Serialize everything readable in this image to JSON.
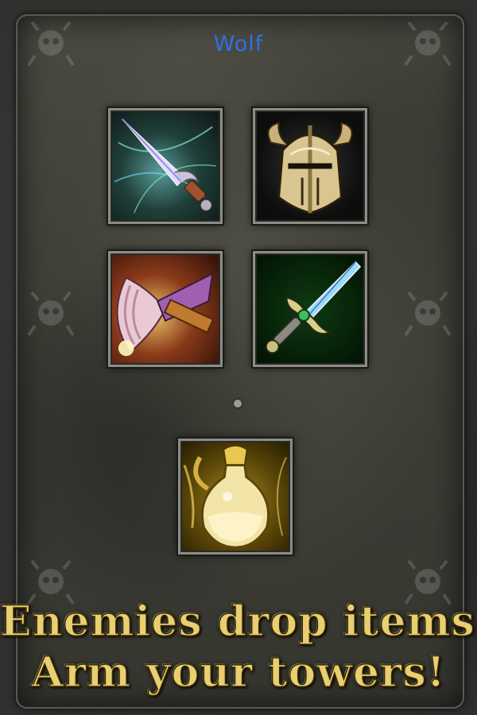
{
  "unit": {
    "name": "Wolf"
  },
  "items": [
    {
      "icon": "enchanted-dagger-icon"
    },
    {
      "icon": "golden-helmet-icon"
    },
    {
      "icon": "battle-axe-icon"
    },
    {
      "icon": "jeweled-sword-icon"
    }
  ],
  "featured_item": {
    "icon": "potion-flask-icon"
  },
  "pagination": {
    "pages": 1,
    "current": 1
  },
  "caption": {
    "line1": "Enemies drop items.",
    "line2": "Arm your towers!"
  },
  "colors": {
    "title": "#2f6fe8",
    "caption_gold": "#e7cf72",
    "panel_stone": "#3f3f38"
  }
}
